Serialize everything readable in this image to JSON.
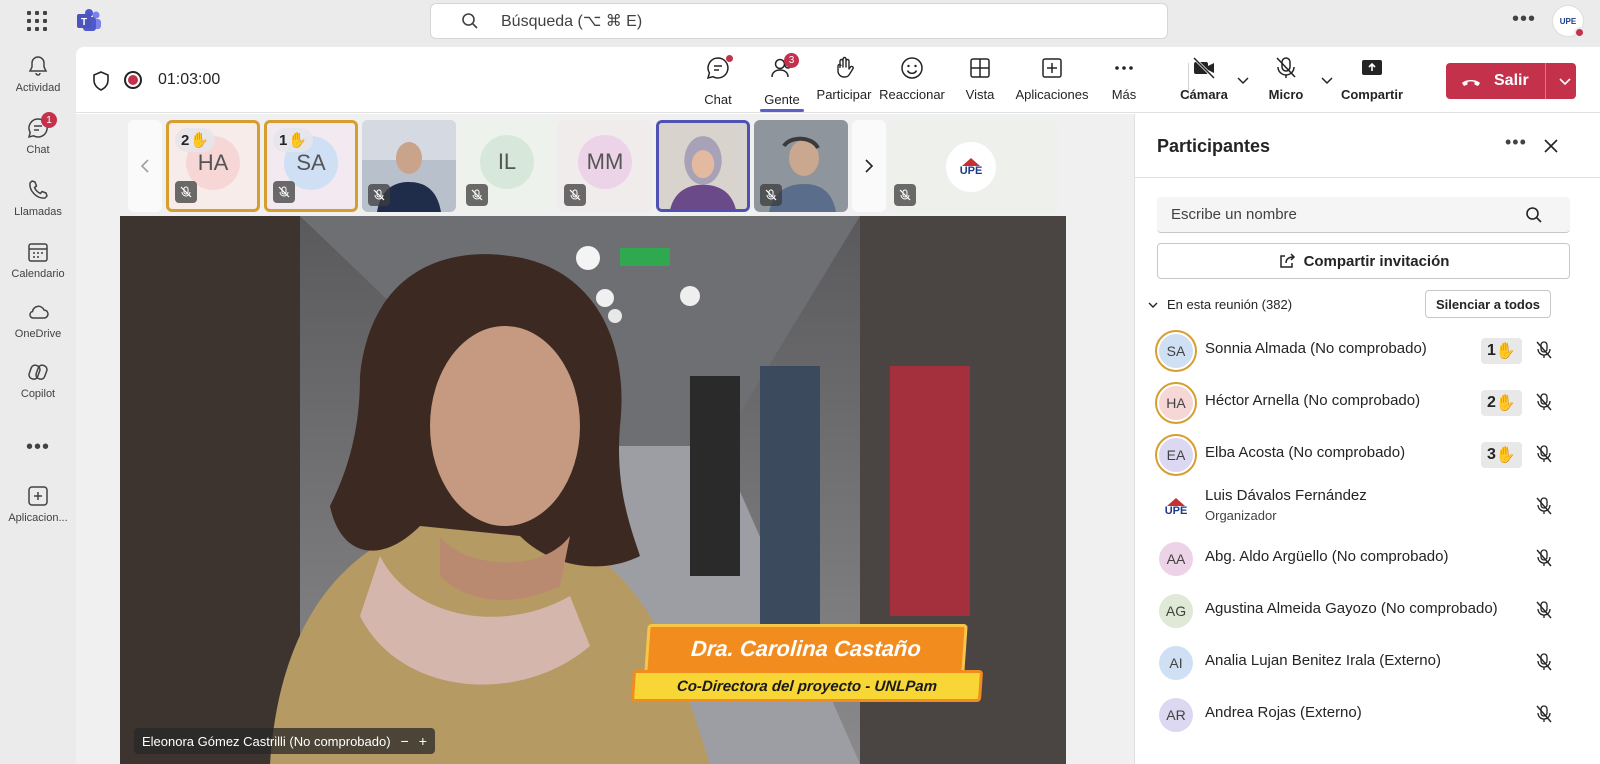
{
  "topbar": {
    "search_placeholder": "Búsqueda (⌥ ⌘ E)"
  },
  "rail": {
    "items": [
      {
        "label": "Actividad",
        "icon": "bell-icon"
      },
      {
        "label": "Chat",
        "icon": "chat-icon",
        "badge": "1"
      },
      {
        "label": "Llamadas",
        "icon": "phone-icon"
      },
      {
        "label": "Calendario",
        "icon": "calendar-icon"
      },
      {
        "label": "OneDrive",
        "icon": "cloud-icon"
      },
      {
        "label": "Copilot",
        "icon": "copilot-icon"
      },
      {
        "label": "Aplicacion...",
        "icon": "add-app-icon"
      }
    ]
  },
  "meeting": {
    "timer": "01:03:00",
    "toolbar": {
      "chat": "Chat",
      "people": "Gente",
      "people_badge": "3",
      "raise": "Participar",
      "react": "Reaccionar",
      "view": "Vista",
      "apps": "Aplicaciones",
      "more": "Más",
      "camera": "Cámara",
      "mic": "Micro",
      "share": "Compartir",
      "leave": "Salir"
    },
    "gallery": [
      {
        "initials": "HA",
        "raise": "2",
        "bg": "#f6d7d5"
      },
      {
        "initials": "SA",
        "raise": "1",
        "bg": "#cfe0f5"
      },
      {
        "initials": "",
        "video": true
      },
      {
        "initials": "IL",
        "bg": "#d7e8da"
      },
      {
        "initials": "MM",
        "bg": "#ecd3e8"
      },
      {
        "initials": "",
        "video": true,
        "speaking": true
      },
      {
        "initials": "",
        "video": true
      },
      {
        "initials": "",
        "logo": "UPE"
      }
    ],
    "main_video": {
      "name_tag": "Eleonora Gómez Castrilli (No comprobado)",
      "overlay_name": "Dra. Carolina Castaño",
      "overlay_role": "Co-Directora del proyecto - UNLPam"
    }
  },
  "panel": {
    "title": "Participantes",
    "search_placeholder": "Escribe un nombre",
    "share_label": "Compartir invitación",
    "section_label": "En esta reunión (382)",
    "mute_all": "Silenciar a todos",
    "participants": [
      {
        "initials": "SA",
        "name": "Sonnia Almada (No comprobado)",
        "raise": "1",
        "bg": "#cfe0f5",
        "hand": true
      },
      {
        "initials": "HA",
        "name": "Héctor Arnella (No comprobado)",
        "raise": "2",
        "bg": "#f6d7d5",
        "hand": true
      },
      {
        "initials": "EA",
        "name": "Elba Acosta (No comprobado)",
        "raise": "3",
        "bg": "#dcd8f2",
        "hand": true
      },
      {
        "initials": "UPE",
        "name": "Luis Dávalos Fernández",
        "role": "Organizador",
        "logo": true
      },
      {
        "initials": "AA",
        "name": "Abg. Aldo Argüello (No comprobado)",
        "bg": "#ecd3e8"
      },
      {
        "initials": "AG",
        "name": "Agustina Almeida Gayozo (No comprobado)",
        "bg": "#dfe9d6"
      },
      {
        "initials": "AI",
        "name": "Analia Lujan Benitez Irala (Externo)",
        "bg": "#cfe0f5"
      },
      {
        "initials": "AR",
        "name": "Andrea Rojas (Externo)",
        "bg": "#dcd8f2"
      }
    ]
  },
  "colors": {
    "accent": "#5b5fc7",
    "leave": "#c4314b",
    "raise_ring": "#d69e2e"
  }
}
